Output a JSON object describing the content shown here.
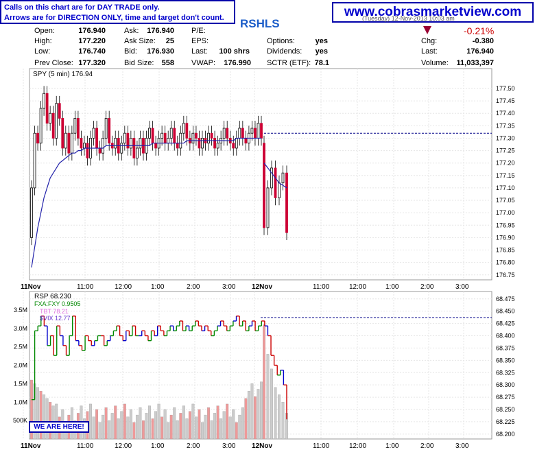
{
  "header": {
    "note_line1": "Calls on this chart are for DAY TRADE only.",
    "note_line2": "Arrows are for DIRECTION ONLY, time and target don't count.",
    "website": "www.cobrasmarketview.com",
    "symbol": "RSHLS",
    "partial_text": "(Tuesday) 12-Nov-2013 10:03 am"
  },
  "quote": {
    "col1": [
      {
        "label": "Open:",
        "value": "176.940"
      },
      {
        "label": "High:",
        "value": "177.220"
      },
      {
        "label": "Low:",
        "value": "176.740"
      },
      {
        "label": "Prev Close:",
        "value": "177.320"
      }
    ],
    "col2": [
      {
        "label": "Ask:",
        "value": "176.940"
      },
      {
        "label": "Ask Size:",
        "value": "25"
      },
      {
        "label": "Bid:",
        "value": "176.930"
      },
      {
        "label": "Bid Size:",
        "value": "558"
      }
    ],
    "col3": [
      {
        "label": "P/E:",
        "value": ""
      },
      {
        "label": "EPS:",
        "value": ""
      },
      {
        "label": "Last:",
        "value": "100 shrs"
      },
      {
        "label": "VWAP:",
        "value": "176.990"
      }
    ],
    "col4": [
      {
        "label": "Options:",
        "value": "yes"
      },
      {
        "label": "Dividends:",
        "value": "yes"
      },
      {
        "label": "Last:",
        "value": "176.940"
      },
      {
        "label": "SCTR (ETF):",
        "value": "78.1"
      }
    ],
    "change_pct": "-0.21%",
    "col5": [
      {
        "label": "Chg:",
        "value": "-0.380"
      },
      {
        "label": "Last:",
        "value": "176.940"
      },
      {
        "label": "Volume:",
        "value": "11,033,397"
      }
    ]
  },
  "colors": {
    "up": "#000000",
    "down": "#cc0033",
    "ma": "#2222aa",
    "reference_line": "#000088",
    "rsp_up": "#008800",
    "rsp_down": "#cc0000",
    "rsp_blue": "#0000cc",
    "tbt": "#e070e0",
    "vix": "#9999cc",
    "fxa": "#88bb88",
    "volume": "#cccccc",
    "volume_red": "#ee9999"
  },
  "overlay": {
    "we_are_here": "WE ARE HERE!"
  },
  "chart_data": [
    {
      "type": "candlestick",
      "legend": "SPY (5 min) 176.94",
      "ylim": [
        176.73,
        177.58
      ],
      "yticks": [
        "177.50",
        "177.40",
        "177.30",
        "177.20",
        "177.10",
        "177.00",
        "176.90",
        "176.80",
        "176.75",
        "177.45",
        "177.35",
        "177.25",
        "177.15",
        "177.05",
        "176.95",
        "176.85"
      ],
      "x_labels": [
        "11Nov",
        "11:00",
        "12:00",
        "1:00",
        "2:00",
        "3:00",
        "12Nov",
        "11:00",
        "12:00",
        "1:00",
        "2:00",
        "3:00"
      ],
      "reference_line": 177.32,
      "day1": {
        "close": [
          177.1,
          177.32,
          177.28,
          177.42,
          177.48,
          177.36,
          177.4,
          177.3,
          177.44,
          177.38,
          177.26,
          177.32,
          177.24,
          177.32,
          177.38,
          177.3,
          177.26,
          177.28,
          177.22,
          177.3,
          177.34,
          177.26,
          177.24,
          177.3,
          177.38,
          177.28,
          177.26,
          177.3,
          177.24,
          177.28,
          177.32,
          177.26,
          177.3,
          177.22,
          177.26,
          177.3,
          177.24,
          177.3,
          177.34,
          177.28,
          177.26,
          177.3,
          177.32,
          177.28,
          177.3,
          177.34,
          177.28,
          177.26,
          177.32,
          177.36,
          177.3,
          177.28,
          177.32,
          177.3,
          177.26,
          177.3,
          177.28,
          177.32,
          177.3,
          177.26,
          177.28,
          177.3,
          177.34,
          177.3,
          177.28,
          177.26,
          177.3,
          177.34,
          177.3,
          177.28,
          177.32,
          177.34,
          177.3,
          177.36,
          177.3
        ],
        "ma": [
          176.78,
          176.86,
          176.94,
          177.0,
          177.06,
          177.1,
          177.14,
          177.16,
          177.18,
          177.2,
          177.21,
          177.22,
          177.23,
          177.24,
          177.24,
          177.25,
          177.25,
          177.26,
          177.26,
          177.26,
          177.26,
          177.26,
          177.26,
          177.26,
          177.27,
          177.27,
          177.27,
          177.27,
          177.27,
          177.27,
          177.27,
          177.27,
          177.27,
          177.27,
          177.27,
          177.27,
          177.27,
          177.27,
          177.27,
          177.28,
          177.28,
          177.28,
          177.28,
          177.28,
          177.28,
          177.28,
          177.28,
          177.28,
          177.28,
          177.28,
          177.29,
          177.29,
          177.29,
          177.29,
          177.29,
          177.29,
          177.29,
          177.29,
          177.29,
          177.29,
          177.29,
          177.29,
          177.29,
          177.29,
          177.29,
          177.29,
          177.3,
          177.3,
          177.3,
          177.3,
          177.3,
          177.3,
          177.3,
          177.3,
          177.3
        ]
      },
      "day2": {
        "close": [
          176.94,
          177.1,
          177.18,
          177.06,
          177.12,
          177.16,
          176.92
        ],
        "ma": [
          177.2,
          177.18,
          177.16,
          177.14,
          177.12,
          177.11,
          177.1
        ]
      }
    },
    {
      "type": "line",
      "title_series": "RSP 68.230",
      "legend": [
        {
          "name": "FXA:FXY 0.9505",
          "color": "#008800"
        },
        {
          "name": "TBT 78.21",
          "color": "#e070e0"
        },
        {
          "name": "$VIX 12.77",
          "color": "#6633cc"
        }
      ],
      "yticks_right": [
        "68.475",
        "68.450",
        "68.425",
        "68.400",
        "68.375",
        "68.350",
        "68.325",
        "68.300",
        "68.275",
        "68.250",
        "68.225",
        "68.200"
      ],
      "yticks_left": [
        "3.5M",
        "3.0M",
        "2.5M",
        "2.0M",
        "1.5M",
        "1.0M",
        "500K"
      ],
      "x_labels": [
        "11Nov",
        "11:00",
        "12:00",
        "1:00",
        "2:00",
        "3:00",
        "12Nov",
        "11:00",
        "12:00",
        "1:00",
        "2:00",
        "3:00"
      ],
      "reference_line": 68.437,
      "rsp": [
        68.27,
        68.41,
        68.42,
        68.44,
        68.42,
        68.38,
        68.4,
        68.36,
        68.42,
        68.4,
        68.38,
        68.36,
        68.4,
        68.44,
        68.39,
        68.38,
        68.37,
        68.4,
        68.39,
        68.38,
        68.39,
        68.4,
        68.4,
        68.38,
        68.39,
        68.4,
        68.41,
        68.42,
        68.4,
        68.39,
        68.41,
        68.4,
        68.42,
        68.4,
        68.4,
        68.41,
        68.4,
        68.39,
        68.41,
        68.4,
        68.42,
        68.41,
        68.4,
        68.41,
        68.42,
        68.41,
        68.42,
        68.43,
        68.41,
        68.42,
        68.41,
        68.42,
        68.43,
        68.42,
        68.41,
        68.42,
        68.41,
        68.4,
        68.41,
        68.42,
        68.43,
        68.42,
        68.41,
        68.42,
        68.43,
        68.44,
        68.42,
        68.43,
        68.41,
        68.42,
        68.43,
        68.41,
        68.42,
        68.43,
        68.42,
        68.4,
        68.36,
        68.34,
        68.32,
        68.33,
        68.3,
        68.23
      ]
    }
  ]
}
